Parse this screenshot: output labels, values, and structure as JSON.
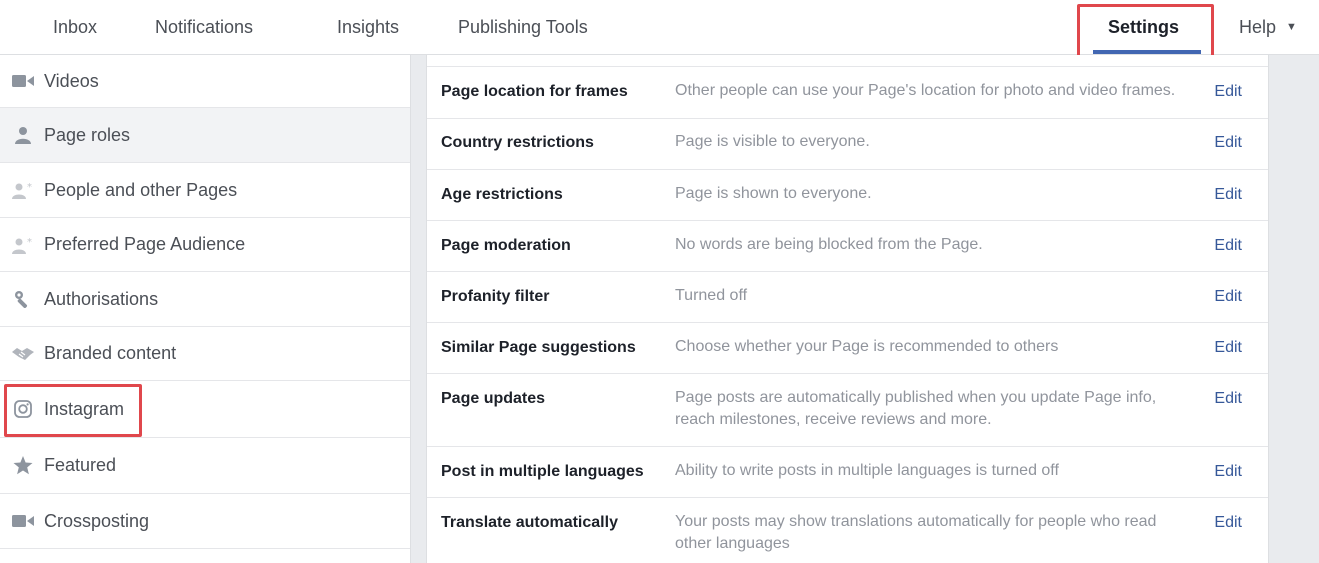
{
  "nav": {
    "inbox": "Inbox",
    "notifications": "Notifications",
    "insights": "Insights",
    "publishing_tools": "Publishing Tools",
    "settings": "Settings",
    "help": "Help",
    "help_caret": "▼"
  },
  "sidebar": {
    "items": [
      {
        "label": "Videos",
        "icon": "video-camera-icon"
      },
      {
        "label": "Page roles",
        "icon": "person-icon"
      },
      {
        "label": "People and other Pages",
        "icon": "person-star-icon"
      },
      {
        "label": "Preferred Page Audience",
        "icon": "person-star-icon"
      },
      {
        "label": "Authorisations",
        "icon": "wrench-icon"
      },
      {
        "label": "Branded content",
        "icon": "handshake-icon"
      },
      {
        "label": "Instagram",
        "icon": "instagram-icon"
      },
      {
        "label": "Featured",
        "icon": "star-icon"
      },
      {
        "label": "Crossposting",
        "icon": "video-camera-icon"
      }
    ]
  },
  "settings": {
    "edit_label": "Edit",
    "rows": [
      {
        "title": "Page location for frames",
        "description": "Other people can use your Page's location for photo and video frames."
      },
      {
        "title": "Country restrictions",
        "description": "Page is visible to everyone."
      },
      {
        "title": "Age restrictions",
        "description": "Page is shown to everyone."
      },
      {
        "title": "Page moderation",
        "description": "No words are being blocked from the Page."
      },
      {
        "title": "Profanity filter",
        "description": "Turned off"
      },
      {
        "title": "Similar Page suggestions",
        "description": "Choose whether your Page is recommended to others"
      },
      {
        "title": "Page updates",
        "description": "Page posts are automatically published when you update Page info, reach milestones, receive reviews and more."
      },
      {
        "title": "Post in multiple languages",
        "description": "Ability to write posts in multiple languages is turned off"
      },
      {
        "title": "Translate automatically",
        "description": "Your posts may show translations automatically for people who read other languages"
      }
    ]
  },
  "colors": {
    "accent": "#4267b2",
    "link": "#365899",
    "highlight": "#e0474c",
    "muted_text": "#90949c",
    "icon_gray": "#8d949e"
  }
}
